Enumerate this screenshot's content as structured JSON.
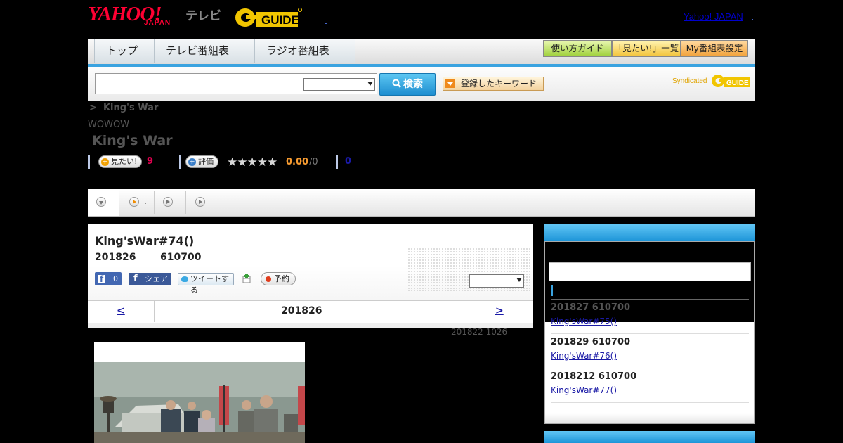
{
  "header": {
    "logo_main": "YAHOO!",
    "logo_sub": "JAPAN",
    "logo_tv": "テレビ",
    "gguide_logo": "G-GUIDE",
    "top_link": "Yahoo! JAPAN"
  },
  "nav": {
    "tabs": [
      "トップ",
      "テレビ番組表",
      "ラジオ番組表"
    ],
    "buttons": [
      "使い方ガイド",
      "「見たい!」一覧",
      "My番組表設定"
    ]
  },
  "search": {
    "input_value": "",
    "select_value": "",
    "button_label": "検索",
    "keyword_button": "登録したキーワード",
    "syndicated": "Syndicated"
  },
  "breadcrumb": {
    "sep": ">",
    "current": "King's War"
  },
  "program": {
    "station": "WOWOW",
    "title": "King's War",
    "mitai_label": "見たい!",
    "mitai_count": "9",
    "hyoka_label": "評価",
    "stars": "★★★★★",
    "score": "0.00",
    "score_count": "/0",
    "review_count": "0"
  },
  "subtabs": {
    "tab2_suffix": "."
  },
  "episode": {
    "title": "King'sWar#74()",
    "date": "201826",
    "time": "610700",
    "fb_like_count": "0",
    "fb_share": "シェア",
    "tweet": "ツイートする",
    "reserve": "予約",
    "select_value": ""
  },
  "date_nav": {
    "prev": "<",
    "current": "201826",
    "next": ">"
  },
  "updated": "201822  1026",
  "sidebar": {
    "items": [
      {
        "date": "201827  610700",
        "link": "King'sWar#75()"
      },
      {
        "date": "201829  610700",
        "link": "King'sWar#76()"
      },
      {
        "date": "2018212  610700",
        "link": "King'sWar#77()"
      }
    ]
  },
  "colors": {
    "accent_blue": "#3aa3e0",
    "brand_red": "#ff0033",
    "score_orange": "#f59a30",
    "count_red": "#e1004f"
  }
}
